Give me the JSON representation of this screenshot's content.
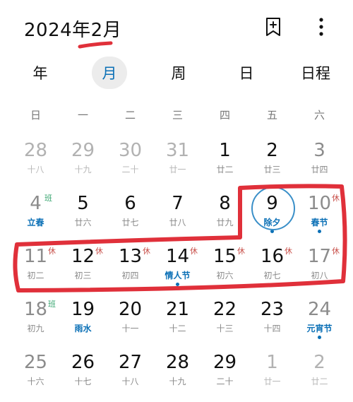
{
  "header": {
    "title": "2024年2月"
  },
  "tabs": [
    {
      "label": "年",
      "active": false
    },
    {
      "label": "月",
      "active": true
    },
    {
      "label": "周",
      "active": false
    },
    {
      "label": "日",
      "active": false
    },
    {
      "label": "日程",
      "active": false
    }
  ],
  "weekdays": [
    "日",
    "一",
    "二",
    "三",
    "四",
    "五",
    "六"
  ],
  "colors": {
    "accent": "#0b70b6",
    "rest": "#c8504a",
    "work": "#3aa671",
    "annotation": "#e0303a"
  },
  "weeks": [
    [
      {
        "day": "28",
        "sub": "十八",
        "other": true
      },
      {
        "day": "29",
        "sub": "十九",
        "other": true
      },
      {
        "day": "30",
        "sub": "二十",
        "other": true
      },
      {
        "day": "31",
        "sub": "廿一",
        "other": true
      },
      {
        "day": "1",
        "sub": "廿二"
      },
      {
        "day": "2",
        "sub": "廿三"
      },
      {
        "day": "3",
        "sub": "廿四",
        "weekend": true
      }
    ],
    [
      {
        "day": "4",
        "sub": "立春",
        "festival": true,
        "badge": "班",
        "badge_type": "work",
        "weekend": true
      },
      {
        "day": "5",
        "sub": "廿六"
      },
      {
        "day": "6",
        "sub": "廿七"
      },
      {
        "day": "7",
        "sub": "廿八"
      },
      {
        "day": "8",
        "sub": "廿九"
      },
      {
        "day": "9",
        "sub": "除夕",
        "festival": true,
        "dot": true,
        "selected": true
      },
      {
        "day": "10",
        "sub": "春节",
        "festival": true,
        "dot": true,
        "badge": "休",
        "badge_type": "rest",
        "weekend": true
      }
    ],
    [
      {
        "day": "11",
        "sub": "初二",
        "badge": "休",
        "badge_type": "rest",
        "weekend": true
      },
      {
        "day": "12",
        "sub": "初三",
        "badge": "休",
        "badge_type": "rest"
      },
      {
        "day": "13",
        "sub": "初四",
        "badge": "休",
        "badge_type": "rest"
      },
      {
        "day": "14",
        "sub": "情人节",
        "festival": true,
        "dot": true,
        "badge": "休",
        "badge_type": "rest"
      },
      {
        "day": "15",
        "sub": "初六",
        "badge": "休",
        "badge_type": "rest"
      },
      {
        "day": "16",
        "sub": "初七",
        "badge": "休",
        "badge_type": "rest"
      },
      {
        "day": "17",
        "sub": "初八",
        "badge": "休",
        "badge_type": "rest",
        "weekend": true
      }
    ],
    [
      {
        "day": "18",
        "sub": "初九",
        "badge": "班",
        "badge_type": "work",
        "weekend": true
      },
      {
        "day": "19",
        "sub": "雨水",
        "festival": true
      },
      {
        "day": "20",
        "sub": "十一"
      },
      {
        "day": "21",
        "sub": "十二"
      },
      {
        "day": "22",
        "sub": "十三"
      },
      {
        "day": "23",
        "sub": "十四"
      },
      {
        "day": "24",
        "sub": "元宵节",
        "festival": true,
        "dot": true,
        "weekend": true
      }
    ],
    [
      {
        "day": "25",
        "sub": "十六",
        "weekend": true
      },
      {
        "day": "26",
        "sub": "十七"
      },
      {
        "day": "27",
        "sub": "十八"
      },
      {
        "day": "28",
        "sub": "十九"
      },
      {
        "day": "29",
        "sub": "二十"
      },
      {
        "day": "1",
        "sub": "廿一",
        "other": true
      },
      {
        "day": "2",
        "sub": "廿二",
        "other": true
      }
    ]
  ]
}
